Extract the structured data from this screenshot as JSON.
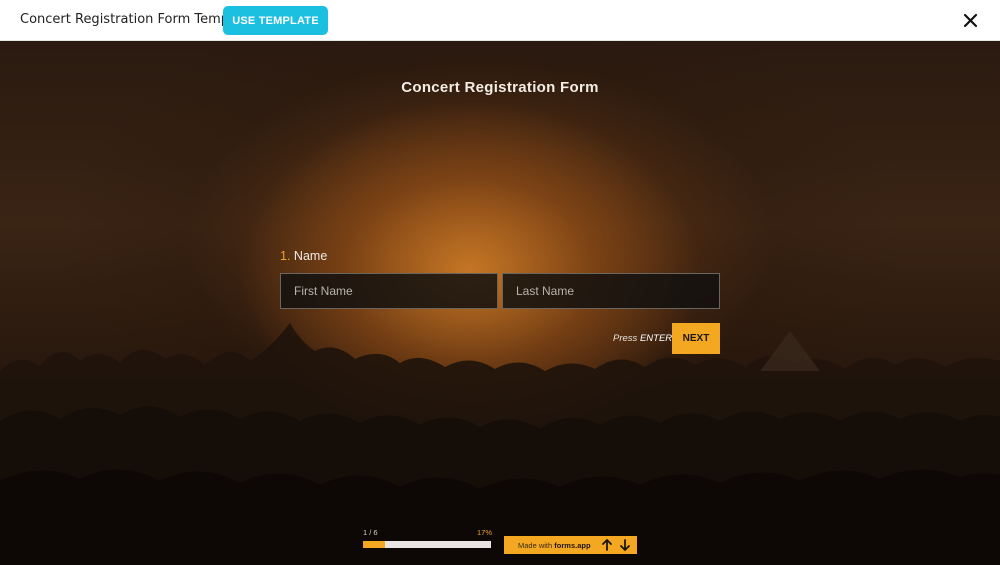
{
  "header": {
    "template_title": "Concert Registration Form Template",
    "use_template_label": "USE TEMPLATE",
    "close_icon": "close-icon"
  },
  "form": {
    "title": "Concert Registration Form",
    "question": {
      "number": "1.",
      "label": "Name",
      "fields": [
        {
          "placeholder": "First Name",
          "value": ""
        },
        {
          "placeholder": "Last Name",
          "value": ""
        }
      ]
    },
    "press_hint_prefix": "Press",
    "press_hint_key": "ENTER",
    "next_label": "NEXT"
  },
  "progress": {
    "count": "1 / 6",
    "percent_label": "17%",
    "fraction": 0.17
  },
  "footer": {
    "made_with_prefix": "Made with",
    "brand": "forms.app",
    "up_icon": "arrow-up-icon",
    "down_icon": "arrow-down-icon"
  },
  "colors": {
    "accent": "#f4a822",
    "use_template_button": "#1bbfe0",
    "question_number": "#f0a12a"
  }
}
